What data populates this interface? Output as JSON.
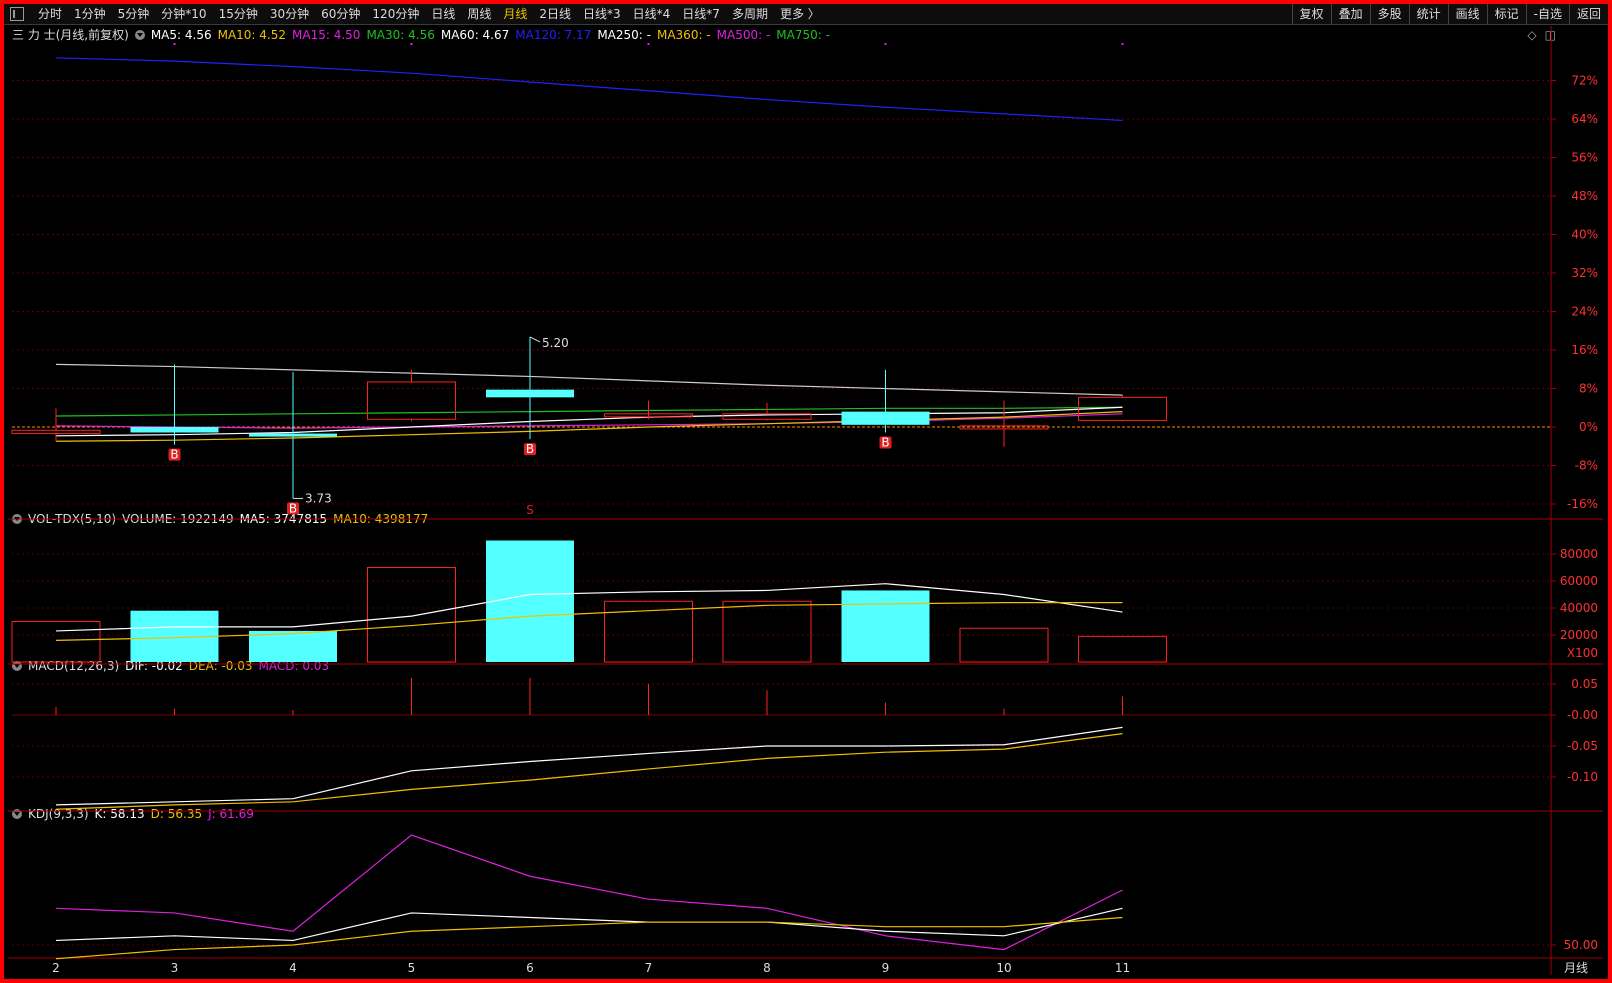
{
  "toolbar": {
    "periods": [
      "分时",
      "1分钟",
      "5分钟",
      "分钟*10",
      "15分钟",
      "30分钟",
      "60分钟",
      "120分钟",
      "日线",
      "周线",
      "月线",
      "2日线",
      "日线*3",
      "日线*4",
      "日线*7",
      "多周期",
      "更多 〉"
    ],
    "active_period": "月线",
    "actions": [
      "复权",
      "叠加",
      "多股",
      "统计",
      "画线",
      "标记",
      "-自选",
      "返回"
    ]
  },
  "price_panel": {
    "title": "三 力 士(月线,前复权)",
    "ma": [
      {
        "label": "MA5: 4.56",
        "color": "#ffffff"
      },
      {
        "label": "MA10: 4.52",
        "color": "#f0c000"
      },
      {
        "label": "MA15: 4.50",
        "color": "#e020e0"
      },
      {
        "label": "MA30: 4.56",
        "color": "#20c020"
      },
      {
        "label": "MA60: 4.67",
        "color": "#ffffff"
      },
      {
        "label": "MA120: 7.17",
        "color": "#2020ff"
      },
      {
        "label": "MA250: -",
        "color": "#ffffff"
      },
      {
        "label": "MA360: -",
        "color": "#f0c000"
      },
      {
        "label": "MA500: -",
        "color": "#e020e0"
      },
      {
        "label": "MA750: -",
        "color": "#20c020"
      }
    ],
    "y_axis_labels": [
      "72%",
      "64%",
      "56%",
      "48%",
      "40%",
      "32%",
      "24%",
      "16%",
      "8%",
      "0%",
      "-8%",
      "-16%"
    ],
    "high_label": "5.20",
    "low_label": "3.73",
    "buy_marker": "B",
    "sell_marker": "S"
  },
  "volume_panel": {
    "title": "VOL-TDX(5,10)",
    "volume": "VOLUME: 1922149",
    "ma5": "MA5: 3747815",
    "ma10": "MA10: 4398177",
    "y_axis_labels": [
      "80000",
      "60000",
      "40000",
      "20000"
    ],
    "unit": "X100"
  },
  "macd_panel": {
    "title": "MACD(12,26,3)",
    "dif": "DIF: -0.02",
    "dea": "DEA: -0.03",
    "macd": "MACD: 0.03",
    "y_axis_labels": [
      "0.05",
      "-0.00",
      "-0.05",
      "-0.10"
    ]
  },
  "kdj_panel": {
    "title": "KDJ(9,3,3)",
    "k": "K: 58.13",
    "d": "D: 56.35",
    "j": "J: 61.69",
    "y_axis_labels": [
      "50.00"
    ]
  },
  "x_axis": {
    "labels": [
      "2",
      "3",
      "4",
      "5",
      "6",
      "7",
      "8",
      "9",
      "10",
      "11"
    ],
    "period_label": "月线"
  },
  "colors": {
    "up": "#ff2020",
    "down": "#54ffff",
    "grid": "#5a0000",
    "axis_text": "#ff3030"
  },
  "chart_data": {
    "type": "candlestick",
    "categories": [
      "2",
      "3",
      "4",
      "5",
      "6",
      "7",
      "8",
      "9",
      "10",
      "11"
    ],
    "candles": [
      {
        "open": 4.32,
        "close": 4.35,
        "high": 4.55,
        "low": 4.25
      },
      {
        "open": 4.38,
        "close": 4.33,
        "high": 4.95,
        "low": 4.22
      },
      {
        "open": 4.32,
        "close": 4.3,
        "high": 4.88,
        "low": 3.73
      },
      {
        "open": 4.45,
        "close": 4.79,
        "high": 4.9,
        "low": 4.43
      },
      {
        "open": 4.72,
        "close": 4.65,
        "high": 5.2,
        "low": 4.27
      },
      {
        "open": 4.5,
        "close": 4.5,
        "high": 4.62,
        "low": 4.45
      },
      {
        "open": 4.45,
        "close": 4.5,
        "high": 4.6,
        "low": 4.44
      },
      {
        "open": 4.52,
        "close": 4.4,
        "high": 4.9,
        "low": 4.33
      },
      {
        "open": 4.37,
        "close": 4.39,
        "high": 4.62,
        "low": 4.2
      },
      {
        "open": 4.44,
        "close": 4.65,
        "high": 4.67,
        "low": 4.43
      }
    ],
    "reference_price": 4.38,
    "ma5": [
      4.3,
      4.31,
      4.33,
      4.38,
      4.43,
      4.47,
      4.49,
      4.5,
      4.51,
      4.56
    ],
    "ma10": [
      4.25,
      4.26,
      4.28,
      4.31,
      4.34,
      4.38,
      4.41,
      4.44,
      4.47,
      4.52
    ],
    "ma15": [
      4.39,
      4.38,
      4.37,
      4.38,
      4.39,
      4.4,
      4.41,
      4.43,
      4.46,
      4.5
    ],
    "ma30": [
      4.48,
      4.49,
      4.5,
      4.51,
      4.52,
      4.53,
      4.54,
      4.55,
      4.55,
      4.56
    ],
    "ma60": [
      4.95,
      4.93,
      4.9,
      4.87,
      4.84,
      4.8,
      4.76,
      4.73,
      4.7,
      4.67
    ],
    "ma120": [
      7.74,
      7.71,
      7.66,
      7.6,
      7.52,
      7.44,
      7.36,
      7.29,
      7.23,
      7.17
    ],
    "volume": [
      30000,
      38000,
      23000,
      70000,
      90000,
      45000,
      45000,
      53000,
      25000,
      19000
    ],
    "volume_ma5": [
      23000,
      26000,
      26000,
      34000,
      50000,
      52000,
      53000,
      58000,
      50000,
      37000
    ],
    "volume_ma10": [
      16000,
      18000,
      21000,
      27000,
      34000,
      38000,
      42000,
      43000,
      44000,
      44000
    ],
    "dif": [
      -0.145,
      -0.14,
      -0.135,
      -0.09,
      -0.075,
      -0.062,
      -0.05,
      -0.05,
      -0.048,
      -0.02
    ],
    "dea": [
      -0.152,
      -0.145,
      -0.14,
      -0.12,
      -0.105,
      -0.087,
      -0.07,
      -0.06,
      -0.055,
      -0.03
    ],
    "macd_hist": [
      0.013,
      0.01,
      0.008,
      0.06,
      0.06,
      0.05,
      0.04,
      0.02,
      0.01,
      0.03
    ],
    "k": [
      51,
      52,
      51,
      57,
      56,
      55,
      55,
      53,
      52,
      58
    ],
    "d": [
      47,
      49,
      50,
      53,
      54,
      55,
      55,
      54,
      54,
      56
    ],
    "j": [
      58,
      57,
      53,
      74,
      65,
      60,
      58,
      52,
      49,
      62
    ]
  }
}
